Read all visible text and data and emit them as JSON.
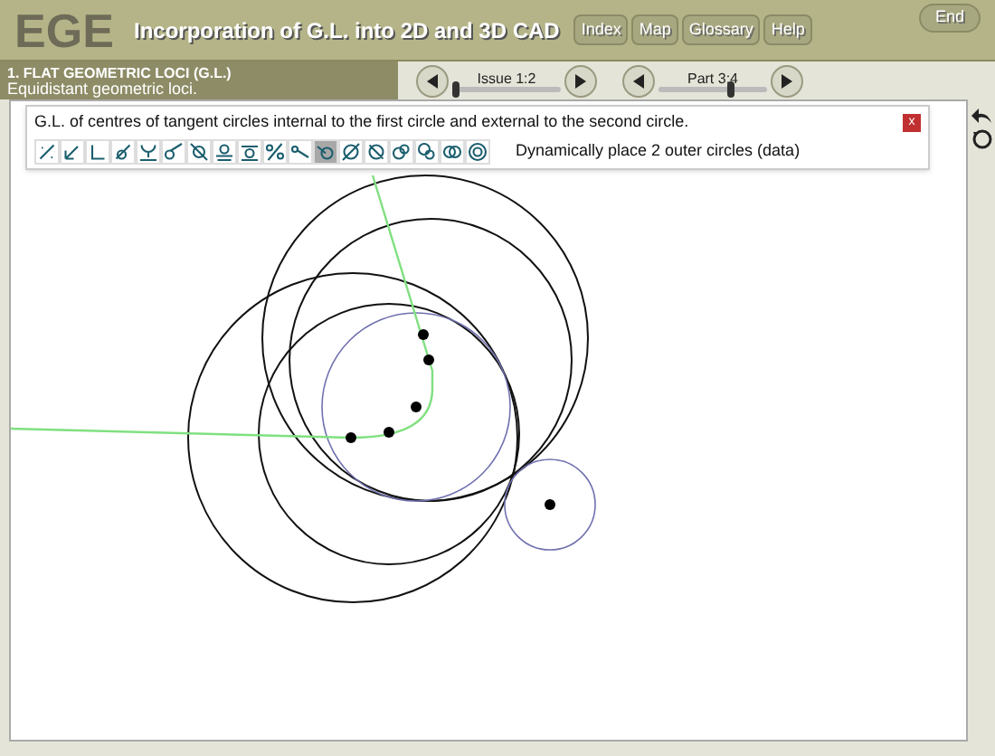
{
  "header": {
    "logo": "EGE",
    "title": "Incorporation of G.L. into 2D and 3D CAD",
    "nav": [
      "Index",
      "Map",
      "Glossary",
      "Help"
    ],
    "end_button": "End"
  },
  "section": {
    "title": "1. FLAT GEOMETRIC LOCI (G.L.)",
    "subtitle": "Equidistant geometric loci."
  },
  "sliders": [
    {
      "label": "Issue 1:2",
      "level": 0.0
    },
    {
      "label": "Part 3:4",
      "level": 0.67
    }
  ],
  "panel": {
    "description": "G.L. of centres of tangent circles internal to the first circle and external to the second circle.",
    "close": "x",
    "status": "Dynamically place 2 outer circles (data)",
    "tools": [
      {
        "selected": false
      },
      {
        "selected": false
      },
      {
        "selected": false
      },
      {
        "selected": false
      },
      {
        "selected": false
      },
      {
        "selected": false
      },
      {
        "selected": false
      },
      {
        "selected": false
      },
      {
        "selected": false
      },
      {
        "selected": false
      },
      {
        "selected": false
      },
      {
        "selected": true
      },
      {
        "selected": false
      },
      {
        "selected": false
      },
      {
        "selected": false
      },
      {
        "selected": false
      },
      {
        "selected": false
      },
      {
        "selected": false
      }
    ]
  }
}
